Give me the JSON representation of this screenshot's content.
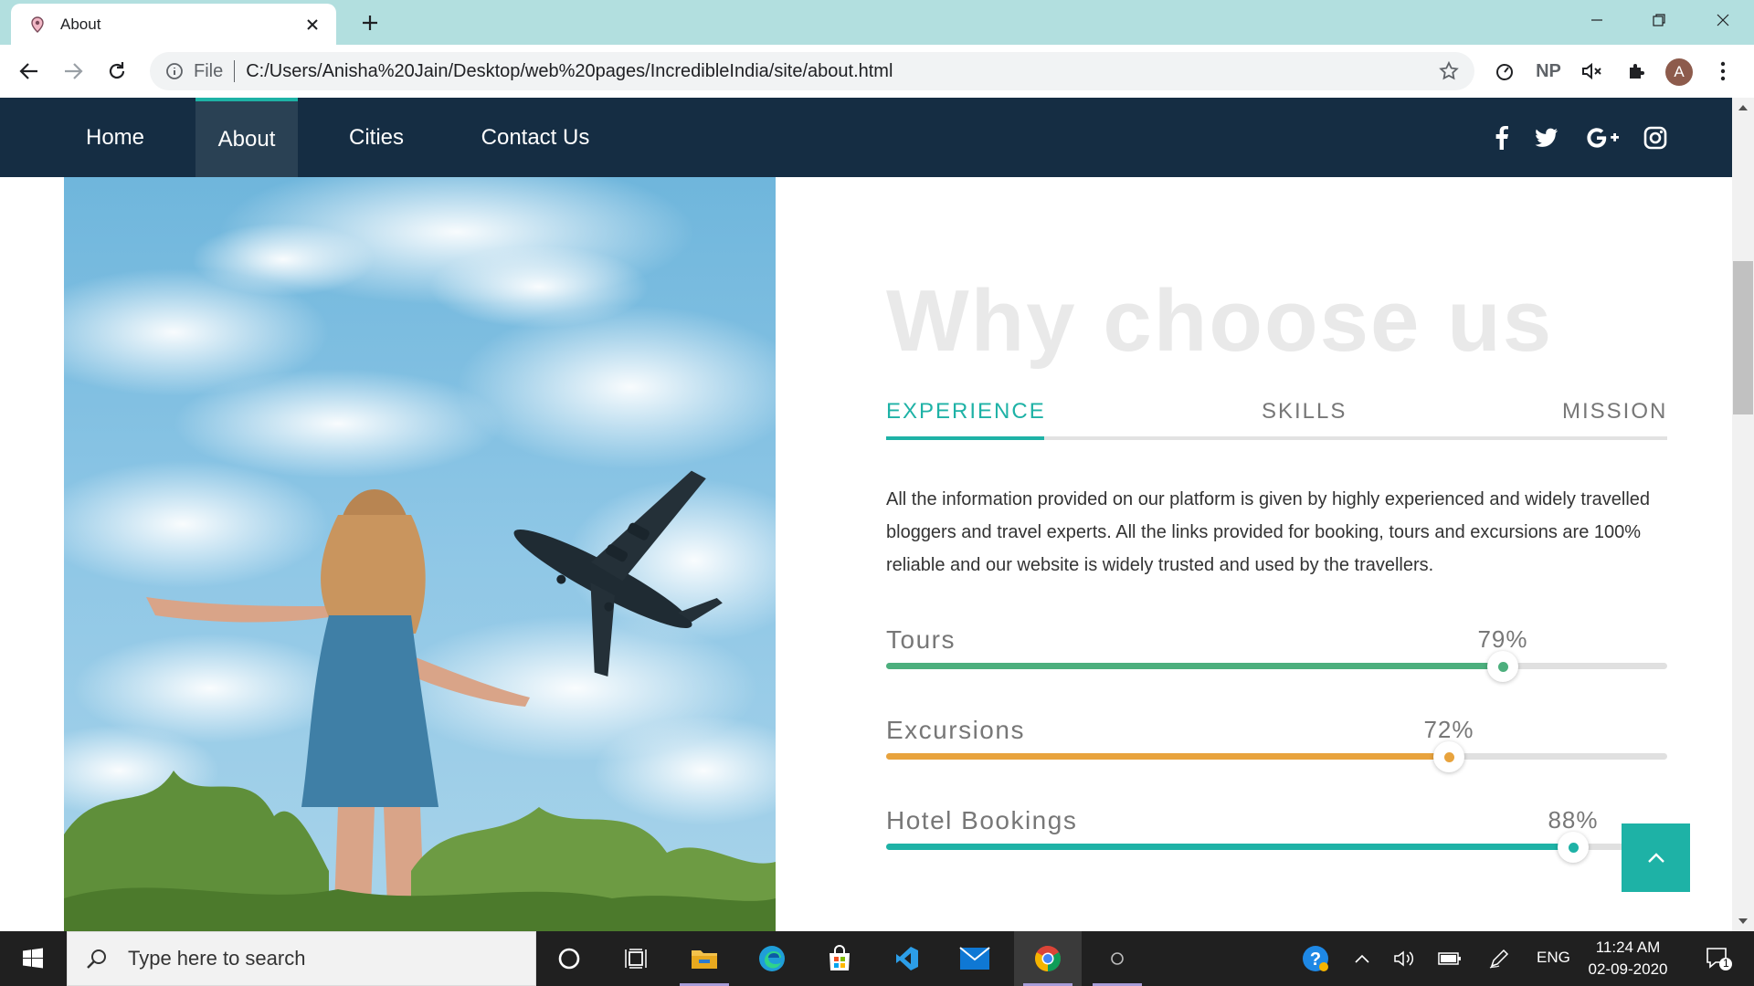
{
  "browser": {
    "tab_title": "About",
    "omnibox_scheme": "File",
    "url": "C:/Users/Anisha%20Jain/Desktop/web%20pages/IncredibleIndia/site/about.html",
    "extension_np": "NP",
    "profile_initial": "A"
  },
  "site": {
    "nav": [
      {
        "label": "Home"
      },
      {
        "label": "About"
      },
      {
        "label": "Cities"
      },
      {
        "label": "Contact Us"
      }
    ],
    "social_icons": [
      "facebook-icon",
      "twitter-icon",
      "google-plus-icon",
      "instagram-icon"
    ],
    "section_title": "Why choose us",
    "tabs": [
      {
        "label": "EXPERIENCE"
      },
      {
        "label": "SKILLS"
      },
      {
        "label": "MISSION"
      }
    ],
    "active_tab": "EXPERIENCE",
    "paragraph": "All the information provided on our platform is given by highly experienced and widely travelled bloggers and travel experts. All the links provided for booking, tours and excursions are 100% reliable and our website is widely trusted and used by the travellers.",
    "skills": [
      {
        "label": "Tours",
        "percent_text": "79%",
        "value": 0.79,
        "color": "#4caf7d"
      },
      {
        "label": "Excursions",
        "percent_text": "72%",
        "value": 0.72,
        "color": "#e8a33d"
      },
      {
        "label": "Hotel Bookings",
        "percent_text": "88%",
        "value": 0.88,
        "color": "#1eb2a6"
      }
    ],
    "accent_color": "#1eb2a6",
    "nav_color": "#152d43"
  },
  "taskbar": {
    "search_placeholder": "Type here to search",
    "language": "ENG",
    "time": "11:24 AM",
    "date": "02-09-2020",
    "notification_count": "1"
  }
}
